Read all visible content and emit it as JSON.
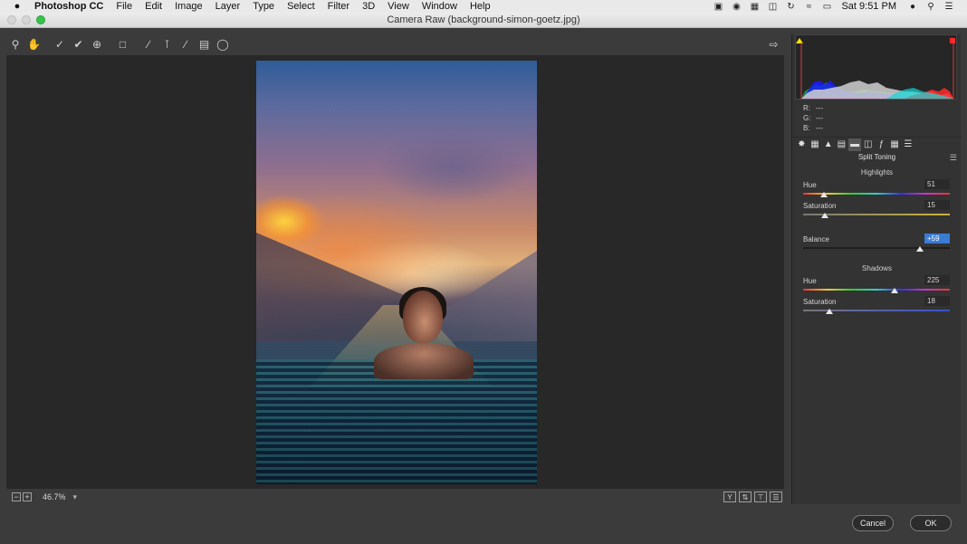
{
  "menubar": {
    "apple_icon": "apple-icon",
    "app_name": "Photoshop CC",
    "items": [
      "File",
      "Edit",
      "Image",
      "Layer",
      "Type",
      "Select",
      "Filter",
      "3D",
      "View",
      "Window",
      "Help"
    ],
    "clock": "Sat 9:51 PM"
  },
  "window": {
    "title": "Camera Raw (background-simon-goetz.jpg)"
  },
  "toolbar": {
    "tools": [
      "zoom-tool-icon",
      "hand-tool-icon",
      "white-balance-tool-icon",
      "color-sampler-tool-icon",
      "targeted-adjustment-tool-icon",
      "crop-tool-icon",
      "straighten-tool-icon",
      "spot-removal-tool-icon",
      "adjustment-brush-icon",
      "graduated-filter-icon",
      "radial-filter-icon"
    ]
  },
  "footer": {
    "zoom_level": "46.7%"
  },
  "readout": {
    "r_label": "R:",
    "r_value": "---",
    "g_label": "G:",
    "g_value": "---",
    "b_label": "B:",
    "b_value": "---"
  },
  "panel": {
    "title": "Split Toning",
    "highlights_heading": "Highlights",
    "shadows_heading": "Shadows",
    "highlights_hue_label": "Hue",
    "highlights_hue_value": "51",
    "highlights_hue_level": 0.14,
    "highlights_sat_label": "Saturation",
    "highlights_sat_value": "15",
    "highlights_sat_level": 0.15,
    "balance_label": "Balance",
    "balance_value": "+59",
    "balance_level": 0.795,
    "shadows_hue_label": "Hue",
    "shadows_hue_value": "225",
    "shadows_hue_level": 0.625,
    "shadows_sat_label": "Saturation",
    "shadows_sat_value": "18",
    "shadows_sat_level": 0.18
  },
  "buttons": {
    "cancel": "Cancel",
    "ok": "OK"
  },
  "colors": {
    "accent": "#3a7bd5",
    "ok_green": "#35c649"
  }
}
